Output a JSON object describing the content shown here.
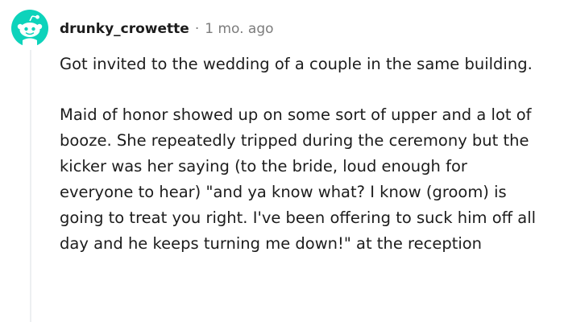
{
  "comment": {
    "username": "drunky_crowette",
    "separator": "·",
    "timestamp": "1 mo. ago",
    "paragraphs": [
      "Got invited to the wedding of a couple in the same building.",
      "Maid of honor showed up on some sort of upper and a lot of booze. She repeatedly tripped during the ceremony but the kicker was her saying (to the bride, loud enough for everyone to hear) \"and ya know what? I know (groom) is going to treat you right. I've been offering to suck him off all day and he keeps turning me down!\" at the reception"
    ],
    "avatar_icon": "snoo-avatar-icon",
    "avatar_color": "#0dd3bb"
  }
}
